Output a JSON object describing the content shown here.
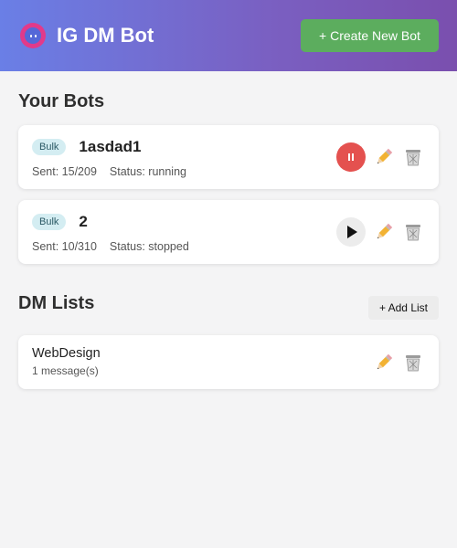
{
  "header": {
    "title": "IG DM Bot",
    "create_label": "+ Create New Bot",
    "logo_icon": "instagram-logo-icon"
  },
  "bots_section": {
    "title": "Your Bots",
    "items": [
      {
        "badge": "Bulk",
        "name": "1asdad1",
        "sent": "Sent: 15/209",
        "status": "Status: running",
        "toggle": "pause"
      },
      {
        "badge": "Bulk",
        "name": "2",
        "sent": "Sent: 10/310",
        "status": "Status: stopped",
        "toggle": "play"
      }
    ]
  },
  "lists_section": {
    "title": "DM Lists",
    "add_label": "+ Add List",
    "items": [
      {
        "name": "WebDesign",
        "count": "1 message(s)"
      }
    ]
  },
  "colors": {
    "header_gradient_start": "#6a7fe6",
    "header_gradient_end": "#7a4fae",
    "create_button": "#5cad5e",
    "pause_button": "#e4514f",
    "badge_bg": "#d4edf2"
  }
}
